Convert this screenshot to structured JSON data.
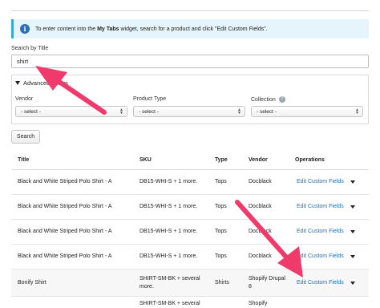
{
  "info": {
    "text_before": "To enter content into the ",
    "text_bold": "My Tabs",
    "text_after": " widget, search for a product and click \"Edit Custom Fields\".",
    "icon": "info-icon"
  },
  "search": {
    "label": "Search by Title",
    "value": "shirt"
  },
  "advanced": {
    "title": "Advanced Filters",
    "vendor": {
      "label": "Vendor",
      "value": "- select -"
    },
    "product_type": {
      "label": "Product Type",
      "value": "- select -"
    },
    "collection": {
      "label": "Collection",
      "value": "- select -",
      "help_icon": "question-icon"
    }
  },
  "search_button": "Search",
  "table": {
    "headers": [
      "Title",
      "SKU",
      "Type",
      "Vendor",
      "Operations"
    ],
    "rows": [
      {
        "title": "Black and White Striped Polo Shirt - A",
        "sku": "DB15-WHI-S + 1 more.",
        "type": "Tops",
        "vendor": "Docblack",
        "op": "Edit Custom Fields"
      },
      {
        "title": "Black and White Striped Polo Shirt - A",
        "sku": "DB15-WHI-S + 1 more.",
        "type": "Tops",
        "vendor": "Docblack",
        "op": "Edit Custom Fields"
      },
      {
        "title": "Black and White Striped Polo Shirt - A",
        "sku": "DB15-WHI-S + 1 more.",
        "type": "Tops",
        "vendor": "Docblack",
        "op": "Edit Custom Fields"
      },
      {
        "title": "Black and White Striped Polo Shirt - A",
        "sku": "DB15-WHI-S + 1 more.",
        "type": "Tops",
        "vendor": "Docblack",
        "op": "Edit Custom Fields"
      },
      {
        "title": "Bonify Shirt",
        "sku": "SHIRT-SM-BK + several more.",
        "type": "Shirts",
        "vendor": "Shopify Drupal 8",
        "op": "Edit Custom Fields"
      },
      {
        "title": "",
        "sku": "SHIRT-SM-BK + several",
        "type": "",
        "vendor": "Shopify",
        "op": ""
      }
    ]
  },
  "colors": {
    "accent": "#1a73c0",
    "arrow": "#ef3a6b",
    "info_bg": "#e6f4fb"
  }
}
